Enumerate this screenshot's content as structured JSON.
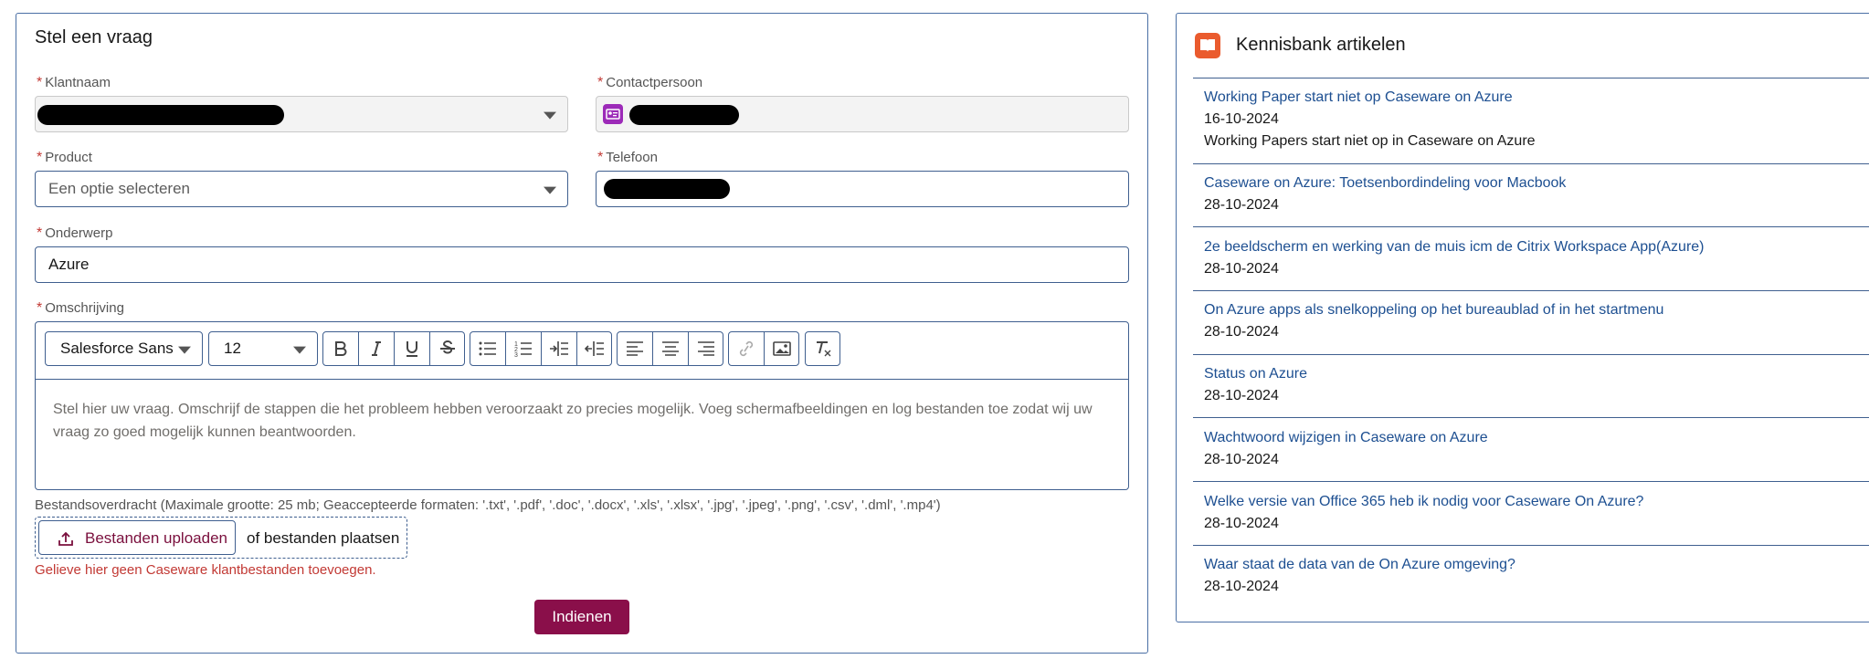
{
  "form": {
    "title": "Stel een vraag",
    "required_marker": "*",
    "klantnaam_label": "Klantnaam",
    "contact_label": "Contactpersoon",
    "product_label": "Product",
    "product_placeholder": "Een optie selecteren",
    "telefoon_label": "Telefoon",
    "onderwerp_label": "Onderwerp",
    "onderwerp_value": "Azure",
    "omschrijving_label": "Omschrijving",
    "font_value": "Salesforce Sans",
    "size_value": "12",
    "editor_placeholder": "Stel hier uw vraag. Omschrijf de stappen die het probleem hebben veroorzaakt zo precies mogelijk. Voeg schermafbeeldingen en log bestanden toe zodat wij uw vraag zo goed mogelijk kunnen beantwoorden.",
    "upload_hint": "Bestandsoverdracht (Maximale grootte: 25 mb; Geaccepteerde formaten: '.txt', '.pdf', '.doc', '.docx', '.xls', '.xlsx', '.jpg', '.jpeg', '.png', '.csv', '.dml', '.mp4')",
    "upload_button": "Bestanden uploaden",
    "drop_text": "of bestanden plaatsen",
    "warning": "Gelieve hier geen Caseware klantbestanden toevoegen.",
    "submit": "Indienen"
  },
  "kb": {
    "title": "Kennisbank artikelen",
    "articles": [
      {
        "title": "Working Paper start niet op Caseware on Azure",
        "date": "16-10-2024",
        "desc": "Working Papers start niet op in Caseware on Azure"
      },
      {
        "title": "Caseware on Azure: Toetsenbordindeling voor Macbook",
        "date": "28-10-2024"
      },
      {
        "title": "2e beeldscherm en werking van de muis icm de Citrix Workspace App(Azure)",
        "date": "28-10-2024"
      },
      {
        "title": "On Azure apps als snelkoppeling op het bureaublad of in het startmenu",
        "date": "28-10-2024"
      },
      {
        "title": "Status on Azure",
        "date": "28-10-2024"
      },
      {
        "title": "Wachtwoord wijzigen in Caseware on Azure",
        "date": "28-10-2024"
      },
      {
        "title": "Welke versie van Office 365 heb ik nodig voor Caseware On Azure?",
        "date": "28-10-2024"
      },
      {
        "title": "Waar staat de data van de On Azure omgeving?",
        "date": "28-10-2024"
      }
    ]
  },
  "colors": {
    "border": "#3f5f8f",
    "accent": "#8a0f4a",
    "link": "#1d4f91",
    "required": "#c23934",
    "kb_icon": "#ea5b2e"
  },
  "icons": [
    "chevron-down-icon",
    "contact-card-icon",
    "bold-icon",
    "italic-icon",
    "underline-icon",
    "strikethrough-icon",
    "bullet-list-icon",
    "numbered-list-icon",
    "indent-icon",
    "outdent-icon",
    "align-left-icon",
    "align-center-icon",
    "align-right-icon",
    "link-icon",
    "image-icon",
    "clear-format-icon",
    "upload-icon",
    "knowledge-book-icon"
  ]
}
